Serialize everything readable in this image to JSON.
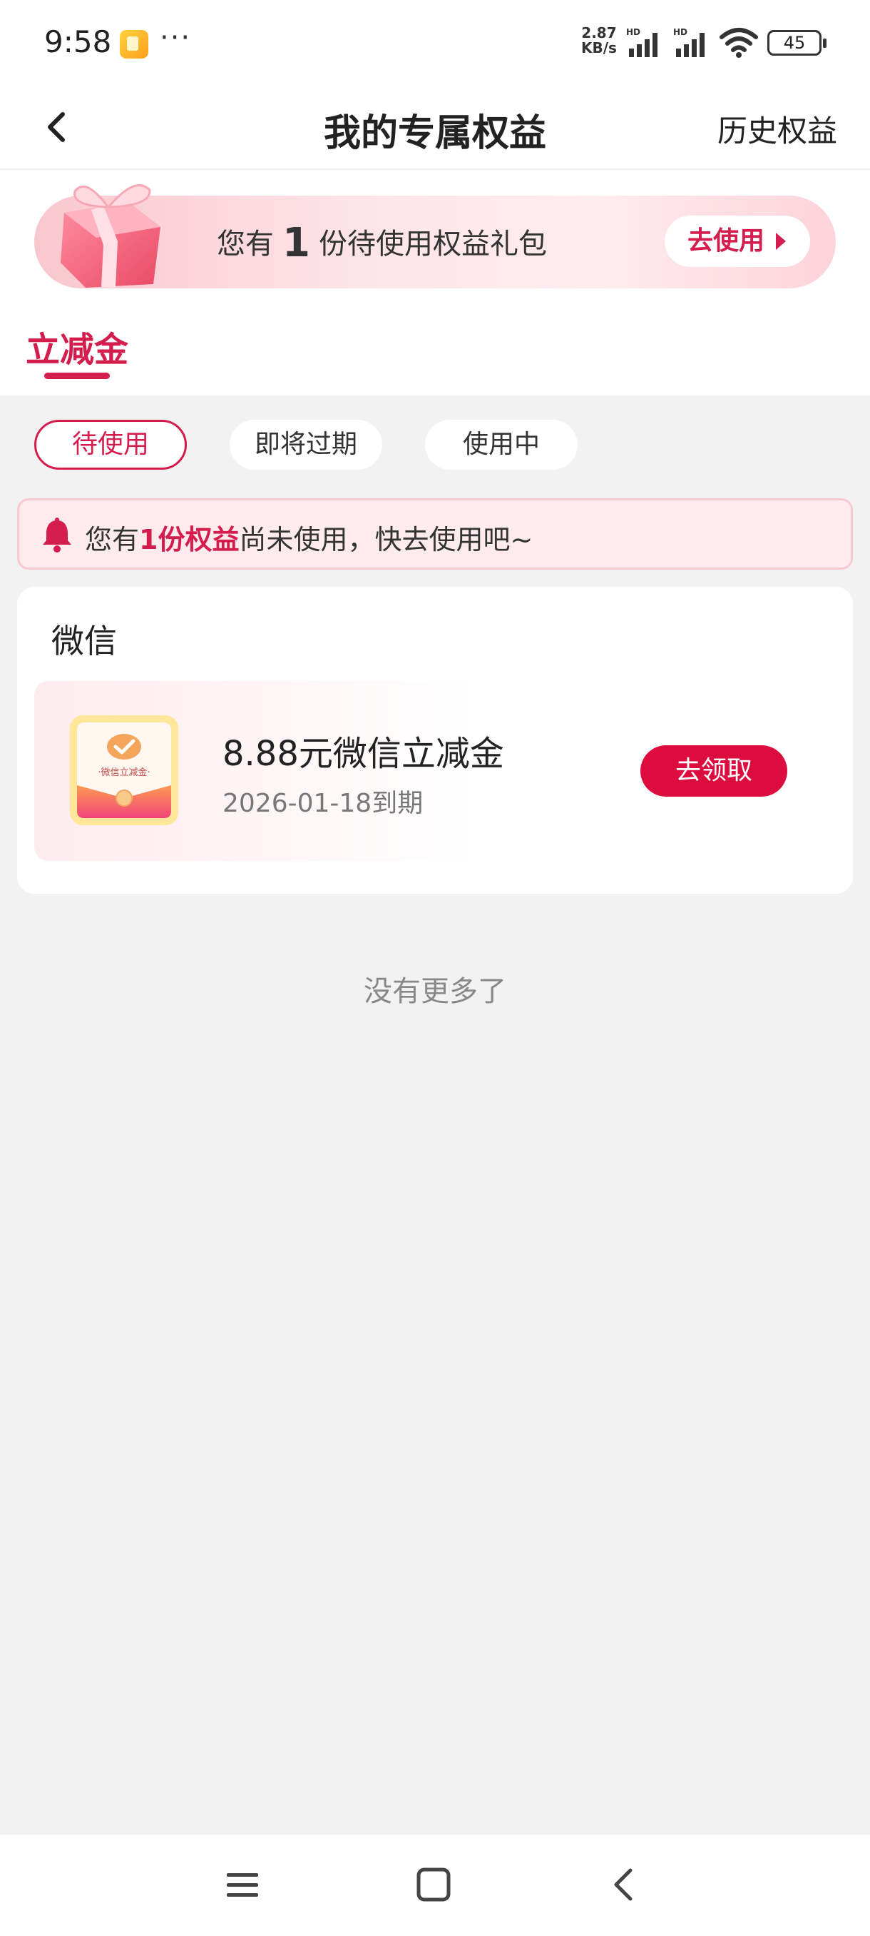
{
  "status_bar": {
    "time": "9:58",
    "more": "···",
    "speed_value": "2.87",
    "speed_unit": "KB/s",
    "battery": "45"
  },
  "nav": {
    "title": "我的专属权益",
    "history": "历史权益"
  },
  "banner": {
    "text_prefix": "您有",
    "count": "1",
    "text_suffix": "份待使用权益礼包",
    "button": "去使用"
  },
  "main_tab": "立减金",
  "filters": [
    {
      "label": "待使用",
      "active": true
    },
    {
      "label": "即将过期",
      "active": false
    },
    {
      "label": "使用中",
      "active": false
    }
  ],
  "notice": {
    "prefix": "您有",
    "highlight": "1份权益",
    "suffix": "尚未使用，快去使用吧~"
  },
  "card": {
    "title": "微信",
    "coupon": {
      "icon_label": "·微信立减金·",
      "name": "8.88元微信立减金",
      "expiry": "2026-01-18到期",
      "button": "去领取"
    }
  },
  "footer_text": "没有更多了",
  "colors": {
    "accent": "#d41d4d",
    "button_red": "#dc0c3f",
    "background": "#f2f2f2"
  }
}
